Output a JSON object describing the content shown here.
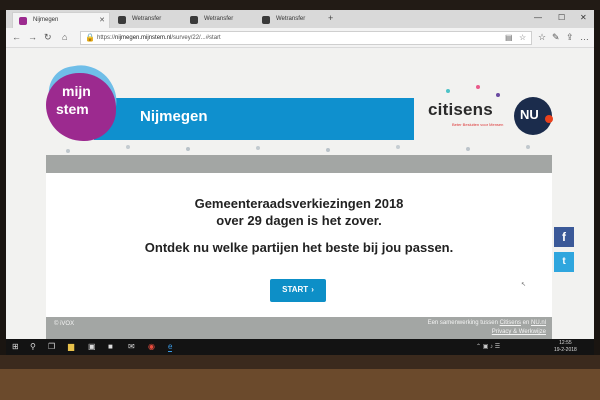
{
  "browser": {
    "tabs": [
      {
        "label": "Nijmegen",
        "favicon_color": "#9c2a8f",
        "active": true
      },
      {
        "label": "Wetransfer",
        "favicon_color": "#3a3a3a",
        "active": false
      },
      {
        "label": "Wetransfer",
        "favicon_color": "#3a3a3a",
        "active": false
      },
      {
        "label": "Wetransfer",
        "favicon_color": "#3a3a3a",
        "active": false
      }
    ],
    "new_tab": "+",
    "window_controls": {
      "minimize": "—",
      "maximize": "☐",
      "close": "✕"
    },
    "nav": {
      "back": "←",
      "forward": "→",
      "refresh": "↻",
      "home": "⌂"
    },
    "url_prefix": "https://",
    "url_host": "nijmegen.mijnstem.nl",
    "url_path": "/survey/22/...#start"
  },
  "page": {
    "logo_line1": "mijn",
    "logo_line2": "stem",
    "banner_title": "Nijmegen",
    "partner_name": "citisens",
    "partner_tagline": "Beter Besluiten voor Mensen",
    "nu_logo_text": "NU",
    "headline_line1": "Gemeenteraadsverkiezingen 2018",
    "headline_line2": "over 29 dagen is het zover.",
    "subline": "Ontdek nu welke partijen het beste bij jou passen.",
    "start_label": "START",
    "start_chevron": "›",
    "copyright": "© iVOX",
    "footer_prefix": "Een samenwerking tussen",
    "footer_link1": "Citisens",
    "footer_and": "en",
    "footer_link2": "NU.nl",
    "privacy_link": "Privacy & Werkwijze",
    "share_facebook": "f",
    "share_twitter": "t"
  },
  "taskbar": {
    "time": "12:55",
    "date": "19-2-2018",
    "tray_icons": "⌃ ▣ ♪ ☰"
  },
  "colors": {
    "banner_blue": "#0f90ce",
    "logo_purple": "#9c2a8f",
    "start_button": "#0d8fc7",
    "facebook": "#3b5998",
    "twitter": "#2fa6de",
    "card_header_grey": "#a3a6a4"
  },
  "icons": [
    "back-icon",
    "forward-icon",
    "refresh-icon",
    "home-icon",
    "lock-icon",
    "reading-view-icon",
    "favorite-star-icon",
    "hub-icon",
    "share-icon",
    "more-icon",
    "start-icon",
    "search-icon",
    "task-view-icon",
    "explorer-icon",
    "store-icon",
    "mail-icon",
    "chrome-icon",
    "edge-icon"
  ]
}
